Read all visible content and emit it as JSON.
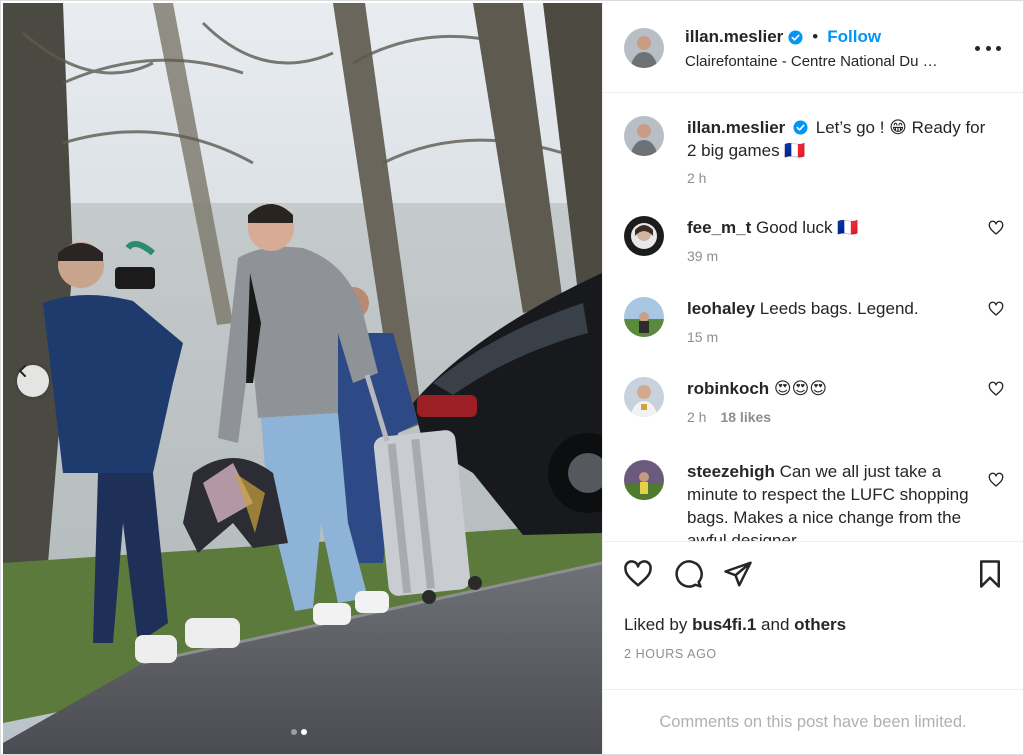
{
  "post": {
    "username": "illan.meslier",
    "follow_label": "Follow",
    "separator": "•",
    "location": "Clairefontaine - Centre National Du …"
  },
  "caption": {
    "username": "illan.meslier",
    "text": "Let’s go ! 😁 Ready for 2 big games 🇫🇷",
    "time": "2 h"
  },
  "comments": [
    {
      "username": "fee_m_t",
      "text": "Good luck 🇫🇷",
      "time": "39 m",
      "likes": ""
    },
    {
      "username": "leohaley",
      "text": "Leeds bags. Legend.",
      "time": "15 m",
      "likes": ""
    },
    {
      "username": "robinkoch",
      "text": "😍😍😍",
      "time": "2 h",
      "likes": "18 likes"
    },
    {
      "username": "steezehigh",
      "text": "Can we all just take a minute to respect the LUFC shopping bags. Makes a nice change from the awful designer",
      "time": "",
      "likes": ""
    }
  ],
  "liked_by": {
    "prefix": "Liked by",
    "user": "bus4fi.1",
    "middle": "and",
    "others": "others"
  },
  "timestamp": "2 HOURS AGO",
  "comments_limited": "Comments on this post have been limited.",
  "carousel": {
    "current": 2,
    "total": 2
  },
  "icons": {
    "verified": "verified-badge-icon",
    "more": "more-options-icon",
    "like": "heart-icon",
    "comment": "comment-icon",
    "share": "share-icon",
    "save": "bookmark-icon",
    "prev": "chevron-left-icon"
  },
  "colors": {
    "accent": "#0095f6",
    "text": "#262626",
    "muted": "#8e8e8e"
  }
}
